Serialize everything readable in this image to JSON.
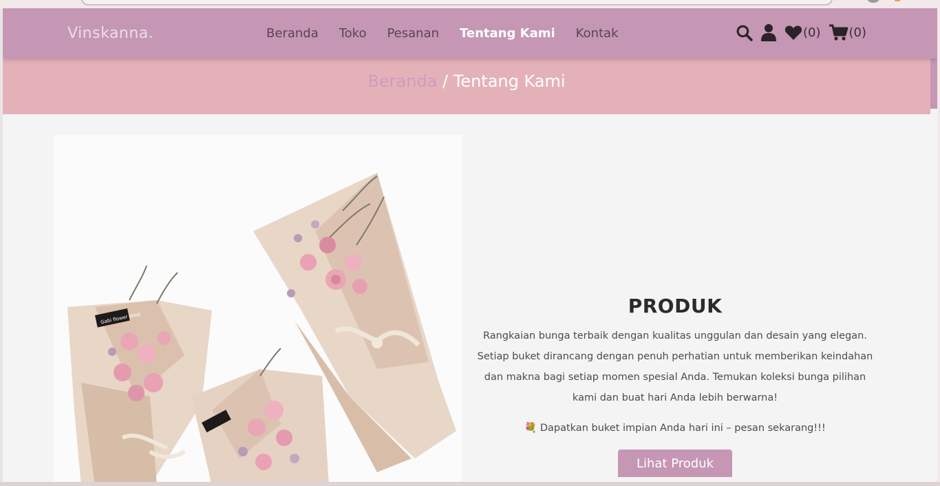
{
  "nav": {
    "logo": "Vinskanna.",
    "menu": [
      {
        "label": "Beranda",
        "active": false
      },
      {
        "label": "Toko",
        "active": false
      },
      {
        "label": "Pesanan",
        "active": false
      },
      {
        "label": "Tentang Kami",
        "active": true
      },
      {
        "label": "Kontak",
        "active": false
      }
    ],
    "wishlist_count": "(0)",
    "cart_count": "(0)"
  },
  "breadcrumb": {
    "home": "Beranda",
    "separator": " / ",
    "current": "Tentang Kami"
  },
  "product": {
    "title": "PRODUK",
    "description": "Rangkaian bunga terbaik dengan kualitas unggulan dan desain yang elegan. Setiap buket dirancang dengan penuh perhatian untuk memberikan keindahan dan makna bagi setiap momen spesial Anda. Temukan koleksi bunga pilihan kami dan buat hari Anda lebih berwarna!",
    "promo_icon": "💐",
    "promo": " Dapatkan buket impian Anda hari ini – pesan sekarang!!!",
    "button_label": "Lihat Produk",
    "image_tag_text": "Gabi flower shop"
  },
  "colors": {
    "nav": "#c597b4",
    "band": "#e5b1b9",
    "accent": "#c597b4",
    "page_bg": "#f4f4f4"
  },
  "icons": [
    "search-icon",
    "user-icon",
    "heart-icon",
    "cart-icon"
  ]
}
